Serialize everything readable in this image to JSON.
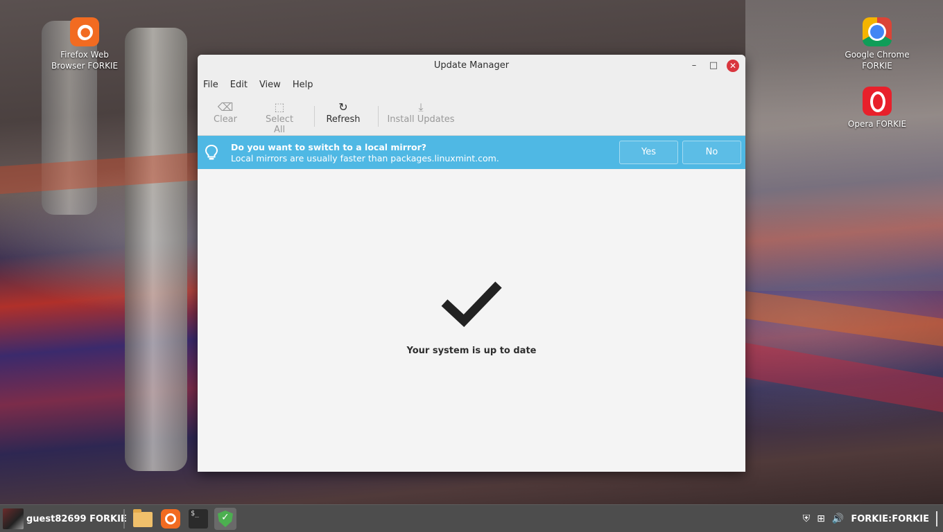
{
  "desktop": {
    "icons": [
      {
        "label": "Firefox Web Browser FORKIE",
        "icon": "firefox-icon"
      },
      {
        "label": "Google Chrome FORKIE",
        "icon": "chrome-icon"
      },
      {
        "label": "Opera FORKIE",
        "icon": "opera-icon"
      }
    ]
  },
  "window": {
    "title": "Update Manager",
    "controls": {
      "minimize": "–",
      "maximize": "□",
      "close": "✕"
    },
    "menu": [
      "File",
      "Edit",
      "View",
      "Help"
    ],
    "toolbar": {
      "clear": {
        "label": "Clear",
        "icon": "⌫",
        "enabled": false
      },
      "select_all": {
        "label": "Select All",
        "icon": "⬚",
        "enabled": false
      },
      "refresh": {
        "label": "Refresh",
        "icon": "↻",
        "enabled": true
      },
      "install": {
        "label": "Install Updates",
        "icon": "⤓",
        "enabled": false
      }
    },
    "infobar": {
      "question": "Do you want to switch to a local mirror?",
      "detail": "Local mirrors are usually faster than packages.linuxmint.com.",
      "yes": "Yes",
      "no": "No",
      "color": "#4fb8e4"
    },
    "status": "Your system is up to date"
  },
  "taskbar": {
    "menu_label": "guest82699 FORKIE",
    "apps": [
      "files-icon",
      "firefox-icon",
      "terminal-icon",
      "update-manager-icon"
    ],
    "terminal_glyph": "$_",
    "tray": {
      "shield": "⛨",
      "network": "⊞",
      "volume": "🔊",
      "clock": "FORKIE:FORKIE"
    }
  }
}
